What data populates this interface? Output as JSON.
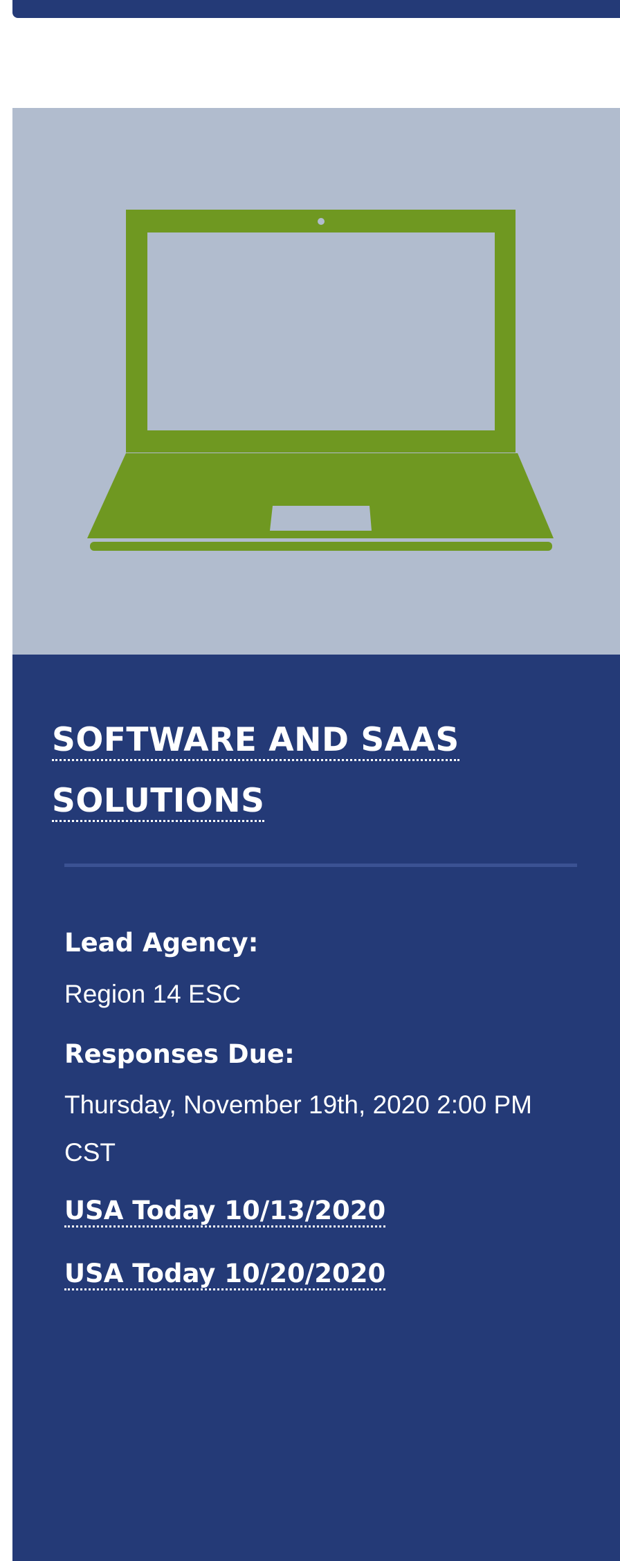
{
  "card": {
    "image_icon": "laptop-icon",
    "title_line1": "SOFTWARE AND SAAS",
    "title_line2": "SOLUTIONS",
    "lead_agency_label": "Lead Agency:",
    "lead_agency_value": "Region 14 ESC",
    "responses_due_label": "Responses Due:",
    "responses_due_value": "Thursday, November 19th, 2020 2:00 PM CST",
    "links": [
      {
        "label": "USA Today 10/13/2020"
      },
      {
        "label": "USA Today 10/20/2020"
      }
    ]
  },
  "colors": {
    "navy": "#243a77",
    "image_bg": "#b1bcce",
    "laptop_green": "#6f9821"
  }
}
